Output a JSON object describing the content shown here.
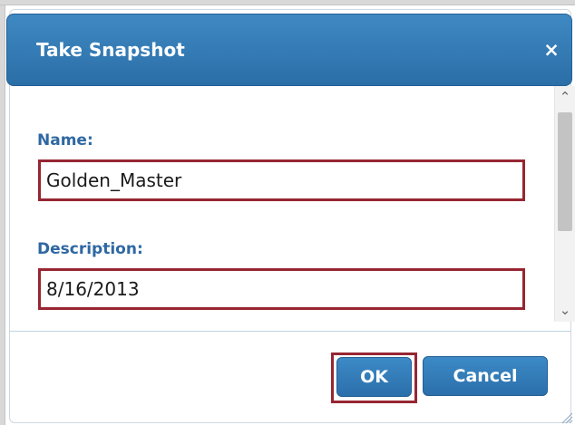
{
  "dialog": {
    "title": "Take Snapshot",
    "close_icon": "close-icon",
    "close_glyph": "×"
  },
  "form": {
    "name_label": "Name:",
    "name_value": "Golden_Master",
    "description_label": "Description:",
    "description_value": "8/16/2013"
  },
  "scrollbar": {
    "up_icon": "chevron-up-icon",
    "up_glyph": "⌃",
    "down_icon": "chevron-down-icon",
    "down_glyph": "⌄"
  },
  "buttons": {
    "ok_label": "OK",
    "cancel_label": "Cancel"
  },
  "colors": {
    "accent": "#2f75b3",
    "label": "#2f68a2",
    "highlight_border": "#972632"
  },
  "resize_icon": "resize-grip-icon"
}
